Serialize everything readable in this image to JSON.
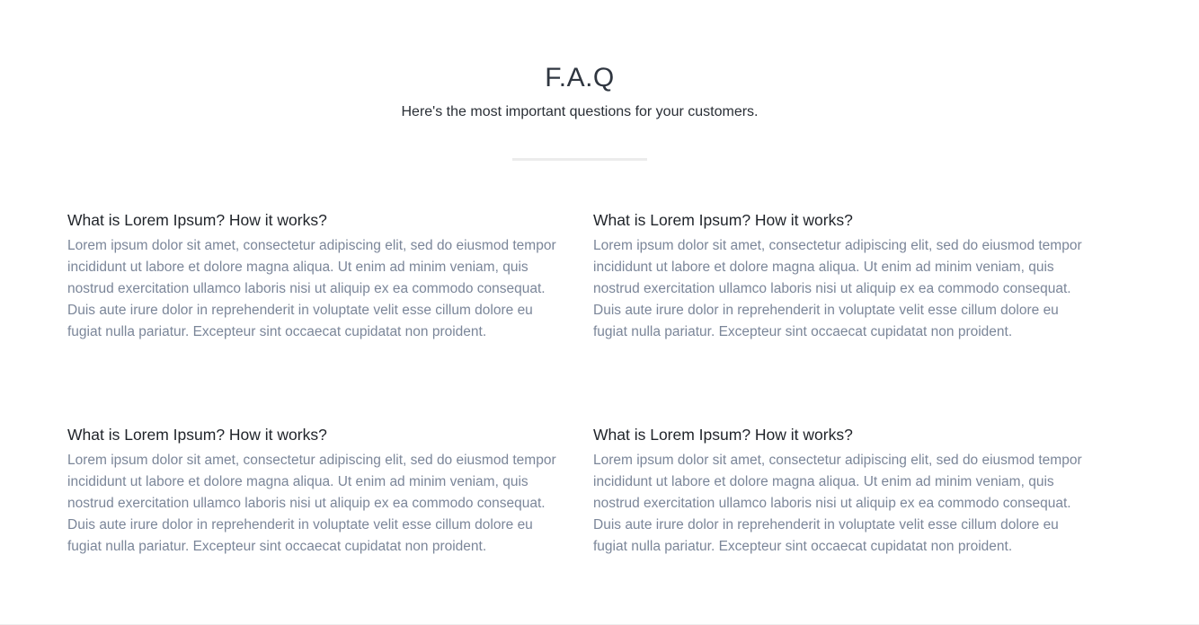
{
  "header": {
    "title": "F.A.Q",
    "subtitle": "Here's the most important questions for your customers."
  },
  "faq": {
    "items": [
      {
        "question": "What is Lorem Ipsum? How it works?",
        "answer": "Lorem ipsum dolor sit amet, consectetur adipiscing elit, sed do eiusmod tempor incididunt ut labore et dolore magna aliqua. Ut enim ad minim veniam, quis nostrud exercitation ullamco laboris nisi ut aliquip ex ea commodo consequat. Duis aute irure dolor in reprehenderit in voluptate velit esse cillum dolore eu fugiat nulla pariatur. Excepteur sint occaecat cupidatat non proident."
      },
      {
        "question": "What is Lorem Ipsum? How it works?",
        "answer": "Lorem ipsum dolor sit amet, consectetur adipiscing elit, sed do eiusmod tempor incididunt ut labore et dolore magna aliqua. Ut enim ad minim veniam, quis nostrud exercitation ullamco laboris nisi ut aliquip ex ea commodo consequat. Duis aute irure dolor in reprehenderit in voluptate velit esse cillum dolore eu fugiat nulla pariatur. Excepteur sint occaecat cupidatat non proident."
      },
      {
        "question": "What is Lorem Ipsum? How it works?",
        "answer": "Lorem ipsum dolor sit amet, consectetur adipiscing elit, sed do eiusmod tempor incididunt ut labore et dolore magna aliqua. Ut enim ad minim veniam, quis nostrud exercitation ullamco laboris nisi ut aliquip ex ea commodo consequat. Duis aute irure dolor in reprehenderit in voluptate velit esse cillum dolore eu fugiat nulla pariatur. Excepteur sint occaecat cupidatat non proident."
      },
      {
        "question": "What is Lorem Ipsum? How it works?",
        "answer": "Lorem ipsum dolor sit amet, consectetur adipiscing elit, sed do eiusmod tempor incididunt ut labore et dolore magna aliqua. Ut enim ad minim veniam, quis nostrud exercitation ullamco laboris nisi ut aliquip ex ea commodo consequat. Duis aute irure dolor in reprehenderit in voluptate velit esse cillum dolore eu fugiat nulla pariatur. Excepteur sint occaecat cupidatat non proident."
      }
    ]
  },
  "colors": {
    "title": "#2f3640",
    "question": "#1f2329",
    "answer": "#7b8699",
    "divider": "#ececec"
  }
}
